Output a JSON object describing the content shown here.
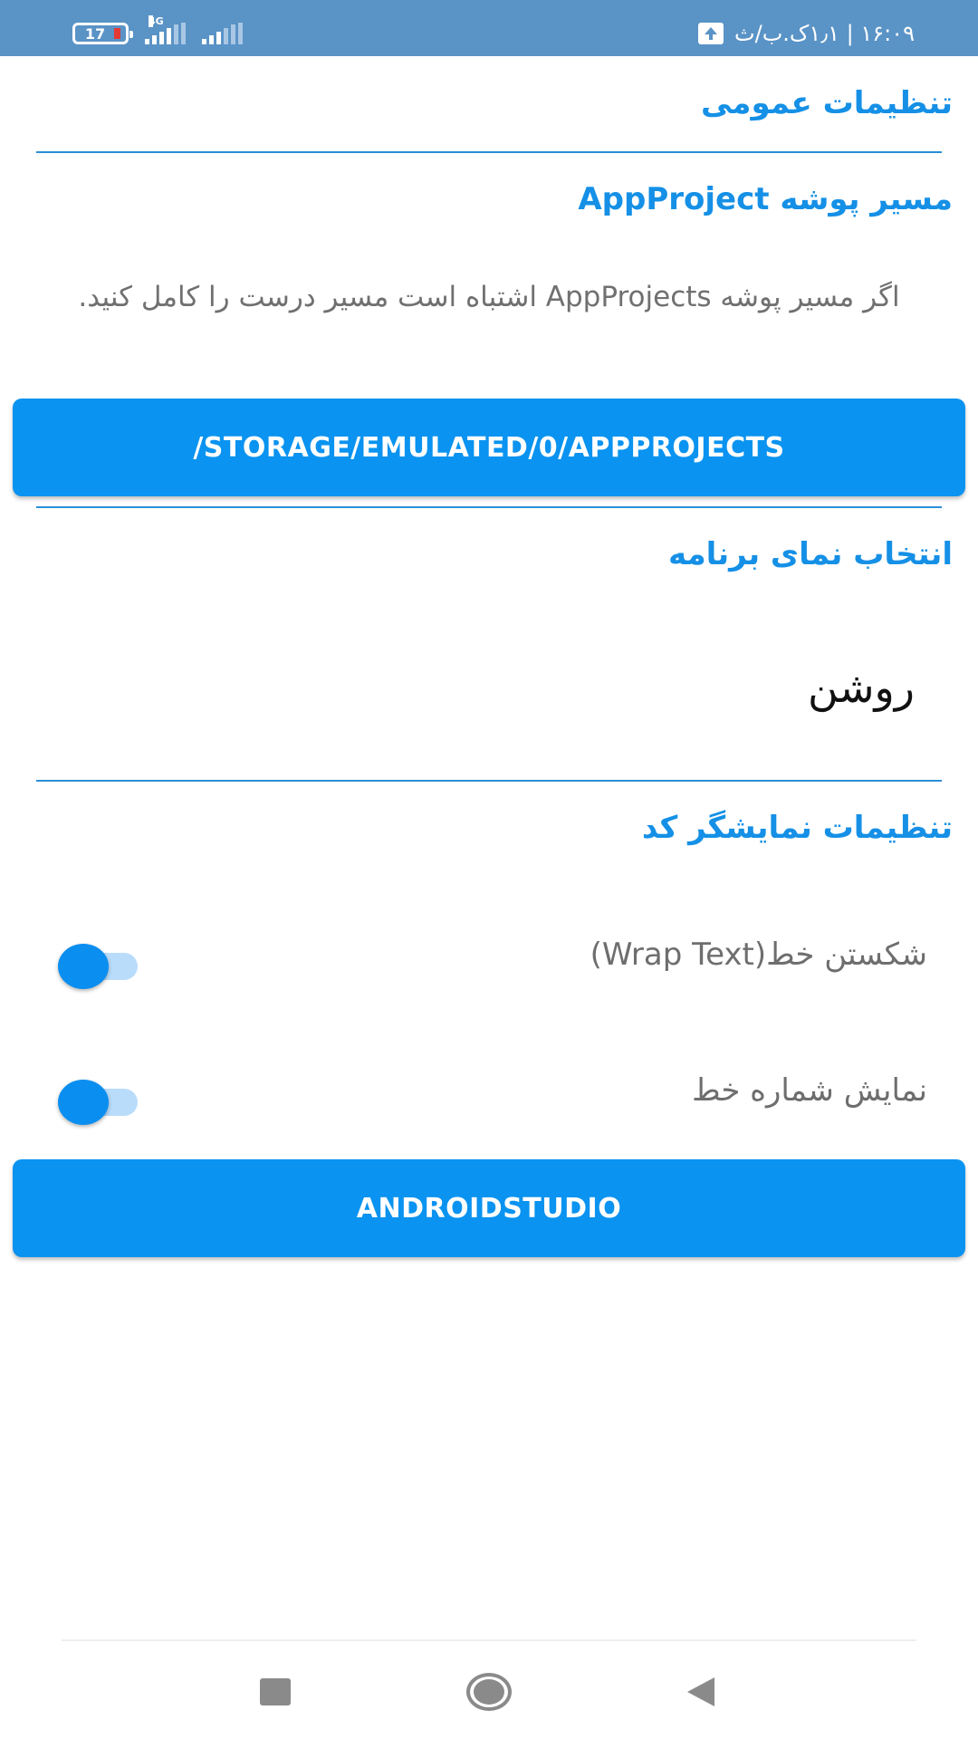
{
  "status_bar": {
    "battery_level": "17",
    "network_type": "4G",
    "time_text": "۱۶:۰۹ | ۱٫۱ک.ب/ث"
  },
  "general_settings": {
    "title": "تنظیمات عمومی"
  },
  "appproject_folder": {
    "title": "مسیر پوشه AppProject",
    "description": "اگر مسیر پوشه AppProjects اشتباه است مسیر درست را کامل کنید.",
    "path_button_label": "/STORAGE/EMULATED/0/APPPROJECTS"
  },
  "theme": {
    "title": "انتخاب نمای برنامه",
    "selected_value": "روشن"
  },
  "code_viewer": {
    "title": "تنظیمات نمایشگر کد",
    "wrap_text_label": "شکستن خط(Wrap Text)",
    "wrap_text_enabled": true,
    "line_numbers_label": "نمایش شماره خط",
    "line_numbers_enabled": true
  },
  "android_studio_button_label": "ANDROIDSTUDIO",
  "colors": {
    "accent": "#0a93f0",
    "section_title": "#1590e6",
    "status_bar": "#5a93c6"
  }
}
